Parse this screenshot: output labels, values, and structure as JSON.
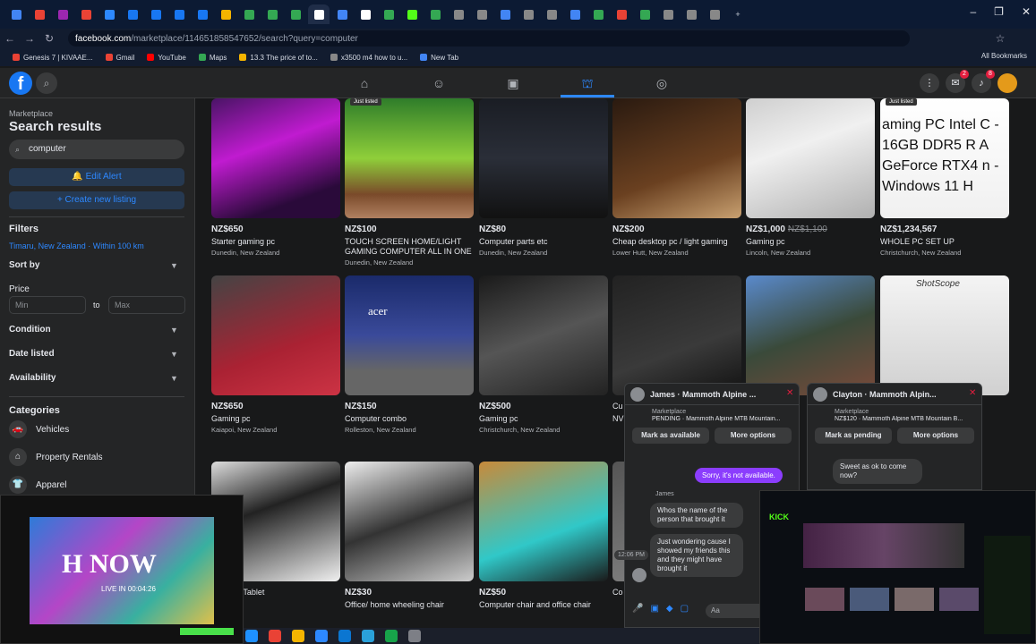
{
  "browser": {
    "tabs": [
      "G",
      "Y",
      "H",
      "M",
      "E",
      "f",
      "f",
      "f",
      "f",
      "Y",
      "J",
      "J",
      "J",
      "I",
      "G",
      "I",
      "A",
      "K",
      "U",
      "C",
      "C",
      "B",
      "C",
      "C",
      "B",
      "A",
      "R",
      "P",
      "C",
      "S",
      "C"
    ],
    "url_host": "facebook.com",
    "url_path": "/marketplace/114651858547652/search?query=computer",
    "bookmarks": [
      "Genesis 7 | KIVAAE...",
      "Gmail",
      "YouTube",
      "Maps",
      "13.3 The price of to...",
      "x3500 m4 how to u...",
      "New Tab"
    ],
    "all_bookmarks": "All Bookmarks",
    "controls": [
      "–",
      "❐",
      "✕"
    ]
  },
  "fbnav": {
    "logo": "f",
    "notif_badge_1": "2",
    "notif_badge_2": "8"
  },
  "sidebar": {
    "section": "Marketplace",
    "title": "Search results",
    "search_value": "computer",
    "edit_alert": "Edit Alert",
    "create_listing": "+ Create new listing",
    "filters": "Filters",
    "location": "Timaru, New Zealand · Within 100 km",
    "sort_by": "Sort by",
    "price": "Price",
    "min_placeholder": "Min",
    "to": "to",
    "max_placeholder": "Max",
    "condition": "Condition",
    "date_listed": "Date listed",
    "availability": "Availability",
    "categories": "Categories",
    "cat_items": [
      "Vehicles",
      "Property Rentals",
      "Apparel"
    ]
  },
  "listings": [
    {
      "price": "NZ$650",
      "name": "Starter gaming pc",
      "loc": "Dunedin, New Zealand",
      "old": ""
    },
    {
      "price": "NZ$100",
      "name": "TOUCH SCREEN HOME/LIGHT GAMING COMPUTER ALL IN ONE",
      "loc": "Dunedin, New Zealand",
      "old": "",
      "badge": "Just listed"
    },
    {
      "price": "NZ$80",
      "name": "Computer parts etc",
      "loc": "Dunedin, New Zealand",
      "old": ""
    },
    {
      "price": "NZ$200",
      "name": "Cheap desktop pc / light gaming",
      "loc": "Lower Hutt, New Zealand",
      "old": ""
    },
    {
      "price": "NZ$1,000",
      "name": "Gaming pc",
      "loc": "Lincoln, New Zealand",
      "old": "NZ$1,100"
    },
    {
      "price": "NZ$1,234,567",
      "name": "WHOLE PC SET UP",
      "loc": "Christchurch, New Zealand",
      "old": "",
      "badge": "Just listed",
      "img_text": "aming PC Intel C - 16GB DDR5 R A GeForce RTX4 n - Windows 11 H"
    },
    {
      "price": "NZ$650",
      "name": "Gaming pc",
      "loc": "Kaiapoi, New Zealand",
      "old": ""
    },
    {
      "price": "NZ$150",
      "name": "Computer combo",
      "loc": "Rolleston, New Zealand",
      "old": "",
      "img_text": "acer"
    },
    {
      "price": "NZ$500",
      "name": "Gaming pc",
      "loc": "Christchurch, New Zealand",
      "old": ""
    },
    {
      "price": "",
      "name": "Cu",
      "loc": "",
      "old": "",
      "extra": "NV"
    },
    {
      "price": "",
      "name": "",
      "loc": "",
      "old": ""
    },
    {
      "price": "",
      "name": "",
      "loc": "",
      "old": "",
      "img_text": "ShotScope"
    },
    {
      "price": "",
      "name": "Drawing Tablet",
      "loc": "",
      "old": ""
    },
    {
      "price": "NZ$30",
      "name": "Office/ home wheeling chair",
      "loc": "",
      "old": ""
    },
    {
      "price": "NZ$50",
      "name": "Computer chair and office chair",
      "loc": "",
      "old": ""
    },
    {
      "price": "",
      "name": "Co",
      "loc": "",
      "old": ""
    }
  ],
  "chats": [
    {
      "name": "James · Mammoth Alpine ...",
      "marketplace": "Marketplace",
      "status": "PENDING · Mammoth Alpine MTB Mountain...",
      "btn1": "Mark as available",
      "btn2": "More options",
      "sent": "Sorry, it's not available.",
      "sender": "James",
      "msg1": "Whos the name of the person that brought it",
      "msg2": "Just wondering cause I showed my friends this and they might have brought it",
      "time": "12:06 PM",
      "input_placeholder": "Aa"
    },
    {
      "name": "Clayton · Mammoth Alpin...",
      "marketplace": "Marketplace",
      "status": "NZ$120 · Mammoth Alpine MTB Mountain B...",
      "btn1": "Mark as pending",
      "btn2": "More options",
      "msg1": "Sweet as ok to come now?"
    }
  ],
  "overlay_left": {
    "brand": "NOW",
    "live": "LIVE IN 00:04:26"
  },
  "overlay_right": {
    "brand": "KICK"
  },
  "colors": {
    "accent": "#2d88ff",
    "fb_blue": "#1877f2",
    "bg": "#18191a",
    "panel": "#242526",
    "purple_bubble": "#8b3dfd"
  }
}
